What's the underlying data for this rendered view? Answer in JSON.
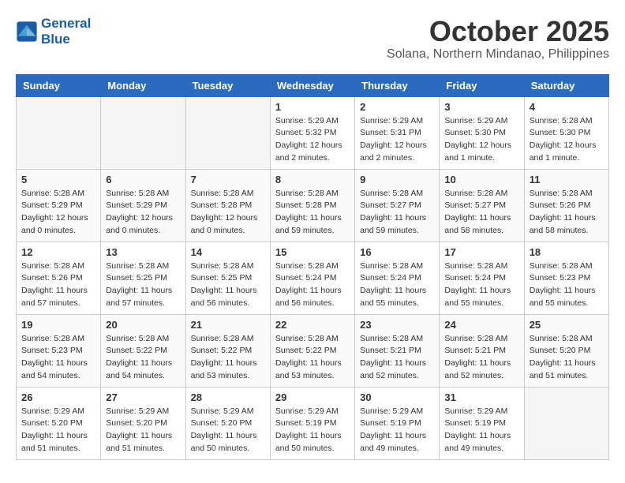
{
  "header": {
    "logo_line1": "General",
    "logo_line2": "Blue",
    "month": "October 2025",
    "location": "Solana, Northern Mindanao, Philippines"
  },
  "weekdays": [
    "Sunday",
    "Monday",
    "Tuesday",
    "Wednesday",
    "Thursday",
    "Friday",
    "Saturday"
  ],
  "weeks": [
    [
      {
        "day": "",
        "sunrise": "",
        "sunset": "",
        "daylight": ""
      },
      {
        "day": "",
        "sunrise": "",
        "sunset": "",
        "daylight": ""
      },
      {
        "day": "",
        "sunrise": "",
        "sunset": "",
        "daylight": ""
      },
      {
        "day": "1",
        "sunrise": "Sunrise: 5:29 AM",
        "sunset": "Sunset: 5:32 PM",
        "daylight": "Daylight: 12 hours and 2 minutes."
      },
      {
        "day": "2",
        "sunrise": "Sunrise: 5:29 AM",
        "sunset": "Sunset: 5:31 PM",
        "daylight": "Daylight: 12 hours and 2 minutes."
      },
      {
        "day": "3",
        "sunrise": "Sunrise: 5:29 AM",
        "sunset": "Sunset: 5:30 PM",
        "daylight": "Daylight: 12 hours and 1 minute."
      },
      {
        "day": "4",
        "sunrise": "Sunrise: 5:28 AM",
        "sunset": "Sunset: 5:30 PM",
        "daylight": "Daylight: 12 hours and 1 minute."
      }
    ],
    [
      {
        "day": "5",
        "sunrise": "Sunrise: 5:28 AM",
        "sunset": "Sunset: 5:29 PM",
        "daylight": "Daylight: 12 hours and 0 minutes."
      },
      {
        "day": "6",
        "sunrise": "Sunrise: 5:28 AM",
        "sunset": "Sunset: 5:29 PM",
        "daylight": "Daylight: 12 hours and 0 minutes."
      },
      {
        "day": "7",
        "sunrise": "Sunrise: 5:28 AM",
        "sunset": "Sunset: 5:28 PM",
        "daylight": "Daylight: 12 hours and 0 minutes."
      },
      {
        "day": "8",
        "sunrise": "Sunrise: 5:28 AM",
        "sunset": "Sunset: 5:28 PM",
        "daylight": "Daylight: 11 hours and 59 minutes."
      },
      {
        "day": "9",
        "sunrise": "Sunrise: 5:28 AM",
        "sunset": "Sunset: 5:27 PM",
        "daylight": "Daylight: 11 hours and 59 minutes."
      },
      {
        "day": "10",
        "sunrise": "Sunrise: 5:28 AM",
        "sunset": "Sunset: 5:27 PM",
        "daylight": "Daylight: 11 hours and 58 minutes."
      },
      {
        "day": "11",
        "sunrise": "Sunrise: 5:28 AM",
        "sunset": "Sunset: 5:26 PM",
        "daylight": "Daylight: 11 hours and 58 minutes."
      }
    ],
    [
      {
        "day": "12",
        "sunrise": "Sunrise: 5:28 AM",
        "sunset": "Sunset: 5:26 PM",
        "daylight": "Daylight: 11 hours and 57 minutes."
      },
      {
        "day": "13",
        "sunrise": "Sunrise: 5:28 AM",
        "sunset": "Sunset: 5:25 PM",
        "daylight": "Daylight: 11 hours and 57 minutes."
      },
      {
        "day": "14",
        "sunrise": "Sunrise: 5:28 AM",
        "sunset": "Sunset: 5:25 PM",
        "daylight": "Daylight: 11 hours and 56 minutes."
      },
      {
        "day": "15",
        "sunrise": "Sunrise: 5:28 AM",
        "sunset": "Sunset: 5:24 PM",
        "daylight": "Daylight: 11 hours and 56 minutes."
      },
      {
        "day": "16",
        "sunrise": "Sunrise: 5:28 AM",
        "sunset": "Sunset: 5:24 PM",
        "daylight": "Daylight: 11 hours and 55 minutes."
      },
      {
        "day": "17",
        "sunrise": "Sunrise: 5:28 AM",
        "sunset": "Sunset: 5:24 PM",
        "daylight": "Daylight: 11 hours and 55 minutes."
      },
      {
        "day": "18",
        "sunrise": "Sunrise: 5:28 AM",
        "sunset": "Sunset: 5:23 PM",
        "daylight": "Daylight: 11 hours and 55 minutes."
      }
    ],
    [
      {
        "day": "19",
        "sunrise": "Sunrise: 5:28 AM",
        "sunset": "Sunset: 5:23 PM",
        "daylight": "Daylight: 11 hours and 54 minutes."
      },
      {
        "day": "20",
        "sunrise": "Sunrise: 5:28 AM",
        "sunset": "Sunset: 5:22 PM",
        "daylight": "Daylight: 11 hours and 54 minutes."
      },
      {
        "day": "21",
        "sunrise": "Sunrise: 5:28 AM",
        "sunset": "Sunset: 5:22 PM",
        "daylight": "Daylight: 11 hours and 53 minutes."
      },
      {
        "day": "22",
        "sunrise": "Sunrise: 5:28 AM",
        "sunset": "Sunset: 5:22 PM",
        "daylight": "Daylight: 11 hours and 53 minutes."
      },
      {
        "day": "23",
        "sunrise": "Sunrise: 5:28 AM",
        "sunset": "Sunset: 5:21 PM",
        "daylight": "Daylight: 11 hours and 52 minutes."
      },
      {
        "day": "24",
        "sunrise": "Sunrise: 5:28 AM",
        "sunset": "Sunset: 5:21 PM",
        "daylight": "Daylight: 11 hours and 52 minutes."
      },
      {
        "day": "25",
        "sunrise": "Sunrise: 5:28 AM",
        "sunset": "Sunset: 5:20 PM",
        "daylight": "Daylight: 11 hours and 51 minutes."
      }
    ],
    [
      {
        "day": "26",
        "sunrise": "Sunrise: 5:29 AM",
        "sunset": "Sunset: 5:20 PM",
        "daylight": "Daylight: 11 hours and 51 minutes."
      },
      {
        "day": "27",
        "sunrise": "Sunrise: 5:29 AM",
        "sunset": "Sunset: 5:20 PM",
        "daylight": "Daylight: 11 hours and 51 minutes."
      },
      {
        "day": "28",
        "sunrise": "Sunrise: 5:29 AM",
        "sunset": "Sunset: 5:20 PM",
        "daylight": "Daylight: 11 hours and 50 minutes."
      },
      {
        "day": "29",
        "sunrise": "Sunrise: 5:29 AM",
        "sunset": "Sunset: 5:19 PM",
        "daylight": "Daylight: 11 hours and 50 minutes."
      },
      {
        "day": "30",
        "sunrise": "Sunrise: 5:29 AM",
        "sunset": "Sunset: 5:19 PM",
        "daylight": "Daylight: 11 hours and 49 minutes."
      },
      {
        "day": "31",
        "sunrise": "Sunrise: 5:29 AM",
        "sunset": "Sunset: 5:19 PM",
        "daylight": "Daylight: 11 hours and 49 minutes."
      },
      {
        "day": "",
        "sunrise": "",
        "sunset": "",
        "daylight": ""
      }
    ]
  ]
}
